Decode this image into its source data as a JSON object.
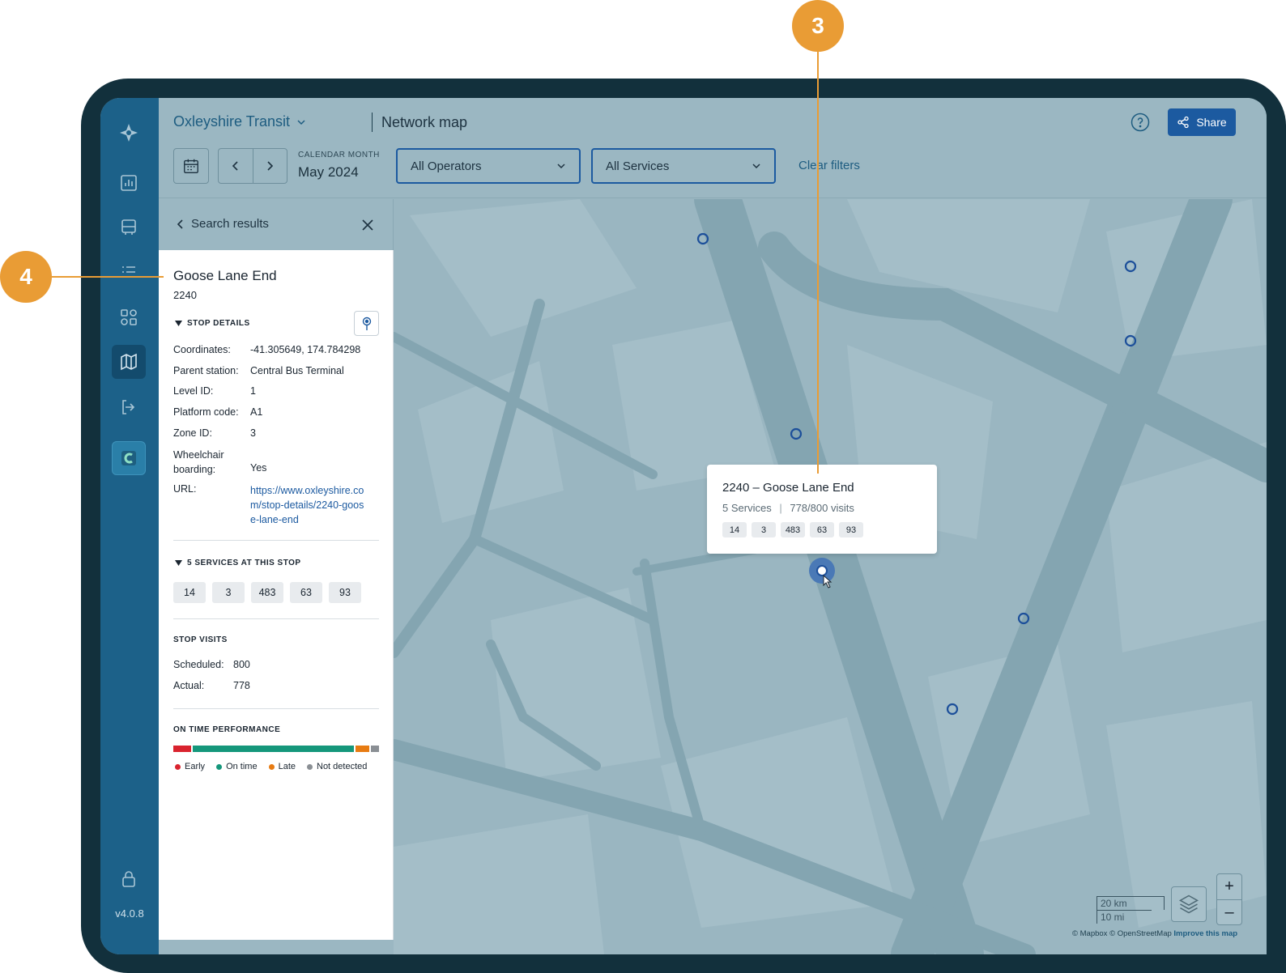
{
  "app": {
    "org_name": "Oxleyshire Transit",
    "page_title": "Network map",
    "share_label": "Share",
    "version": "v4.0.8"
  },
  "filters": {
    "month_label": "CALENDAR MONTH",
    "month_value": "May 2024",
    "operators": "All Operators",
    "services": "All Services",
    "clear_label": "Clear filters"
  },
  "panel": {
    "back_label": "Search results",
    "stop_name": "Goose Lane End",
    "stop_code": "2240",
    "details_heading": "STOP DETAILS",
    "details": [
      {
        "key": "Coordinates:",
        "value": "-41.305649, 174.784298"
      },
      {
        "key": "Parent station:",
        "value": "Central Bus Terminal"
      },
      {
        "key": "Level ID:",
        "value": "1"
      },
      {
        "key": "Platform code:",
        "value": "A1"
      },
      {
        "key": "Zone ID:",
        "value": "3"
      },
      {
        "key": "Wheelchair boarding:",
        "value": "Yes"
      },
      {
        "key": "URL:",
        "value": "https://www.oxleyshire.com/stop-details/2240-goose-lane-end"
      }
    ],
    "services_heading": "5 SERVICES AT THIS STOP",
    "services": [
      "14",
      "3",
      "483",
      "63",
      "93"
    ],
    "visits_heading": "STOP VISITS",
    "visits": [
      {
        "key": "Scheduled:",
        "value": "800"
      },
      {
        "key": "Actual:",
        "value": "778"
      }
    ],
    "performance_heading": "ON TIME PERFORMANCE",
    "performance": [
      {
        "label": "Early",
        "share": 0.09,
        "color": "#d9232e"
      },
      {
        "label": "On time",
        "share": 0.8,
        "color": "#15977b"
      },
      {
        "label": "Late",
        "share": 0.07,
        "color": "#e77b12"
      },
      {
        "label": "Not detected",
        "share": 0.04,
        "color": "#8a8f94"
      }
    ]
  },
  "popup": {
    "title": "2240 – Goose Lane End",
    "services_text": "5 Services",
    "visits_text": "778/800 visits",
    "services": [
      "14",
      "3",
      "483",
      "63",
      "93"
    ]
  },
  "map": {
    "scale_km": "20 km",
    "scale_mi": "10 mi",
    "attribution_1": "© Mapbox © OpenStreetMap",
    "attribution_2": "Improve this map",
    "zoom_in": "+",
    "zoom_out": "–"
  },
  "callouts": {
    "three": "3",
    "four": "4"
  }
}
